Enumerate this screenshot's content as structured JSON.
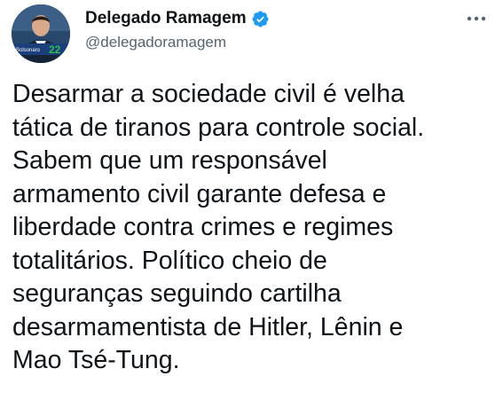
{
  "author": {
    "display_name": "Delegado Ramagem",
    "handle": "@delegadoramagem",
    "verified": true,
    "avatar_badge_text": "Bolsonaro 22"
  },
  "tweet": {
    "text": "Desarmar a sociedade civil é velha\ntática de tiranos para controle social.\nSabem que um responsável\narmamento civil garante defesa e\nliberdade contra crimes e regimes\ntotalitários. Político cheio de\nseguranças seguindo cartilha\ndesarmamentista de Hitler, Lênin e\nMao Tsé-Tung."
  },
  "icons": {
    "verified": "verified-badge-icon",
    "more": "more-options-icon"
  },
  "colors": {
    "verified_blue": "#1d9bf0",
    "text": "#0f1419",
    "secondary_text": "#536471",
    "avatar_badge": "#2fbd4a"
  }
}
